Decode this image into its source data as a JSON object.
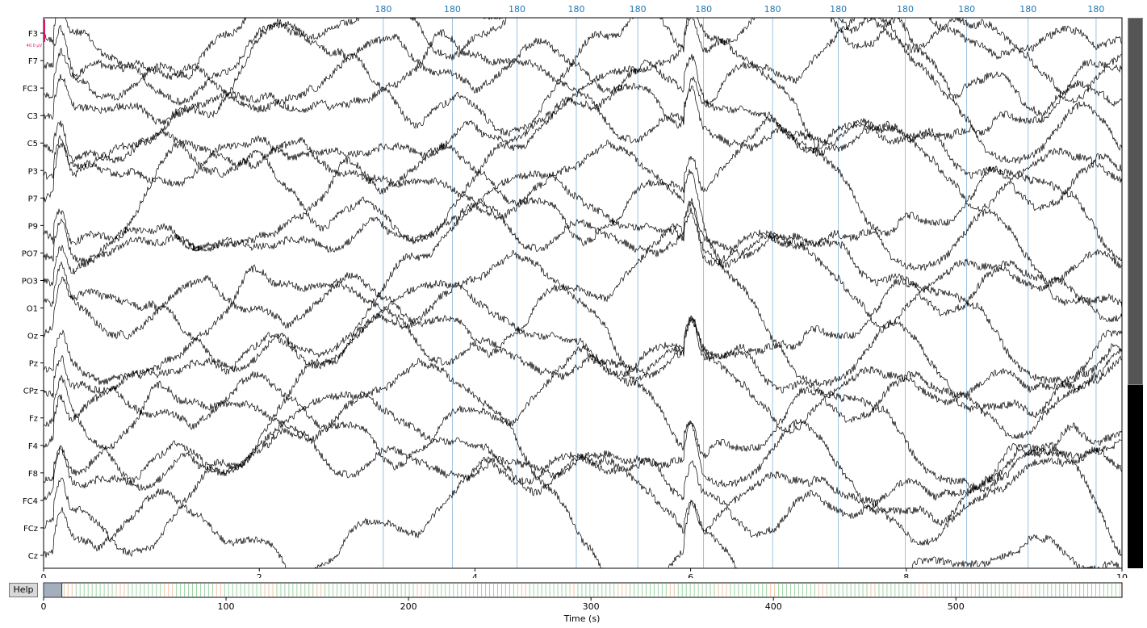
{
  "channels": [
    "F3",
    "F7",
    "FC3",
    "C3",
    "C5",
    "P3",
    "P7",
    "P9",
    "PO7",
    "PO3",
    "O1",
    "Oz",
    "Pz",
    "CPz",
    "Fz",
    "F4",
    "F8",
    "FC4",
    "FCz",
    "Cz"
  ],
  "time_axis": {
    "ticks": [
      "0",
      "2",
      "4",
      "6",
      "8",
      "10"
    ],
    "xlim": [
      0,
      10
    ]
  },
  "annotations": {
    "label": "180",
    "times": [
      3.15,
      3.79,
      4.39,
      4.94,
      5.51,
      6.12,
      6.76,
      7.37,
      7.99,
      8.56,
      9.13,
      9.76
    ],
    "color": "#1f77b4"
  },
  "scalebar": {
    "label": "40.0 µV",
    "color": "#d6186a"
  },
  "overview": {
    "ticks": [
      "0",
      "100",
      "200",
      "300",
      "400",
      "500"
    ],
    "xlabel": "Time (s)",
    "xlim": [
      0,
      591
    ],
    "view_window": [
      0,
      10
    ]
  },
  "help_button": {
    "label": "Help"
  },
  "vscroll": {
    "visible_fraction": 0.667
  },
  "trace_color": "#000000"
}
